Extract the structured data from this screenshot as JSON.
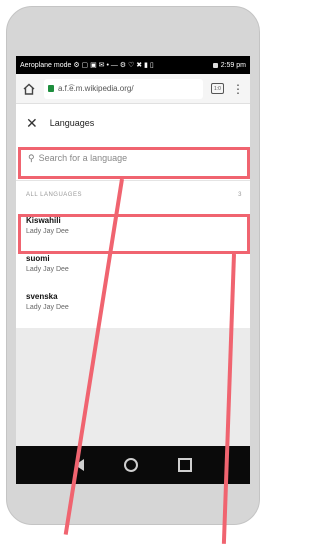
{
  "statusbar": {
    "left_text": "Aeroplane mode ⚙ ▢ ▣ ✉ • — ⚙ ♡ ✖ ▮ ▯",
    "time": "2:59 pm"
  },
  "browser": {
    "url": "a.f.͡e.m.wikipedia.org/",
    "tab_count": "1:0",
    "menu_icon": "vertical-dots"
  },
  "languages_page": {
    "title": "Languages",
    "search_placeholder": "Search for a language",
    "section_label": "ALL LANGUAGES",
    "section_count": "3",
    "items": [
      {
        "name": "Kiswahili",
        "subtitle": "Lady Jay Dee"
      },
      {
        "name": "suomi",
        "subtitle": "Lady Jay Dee"
      },
      {
        "name": "svenska",
        "subtitle": "Lady Jay Dee"
      }
    ]
  },
  "colors": {
    "highlight": "#f06470",
    "status_bar": "#000000",
    "nav_bar": "#0a0a0a"
  }
}
